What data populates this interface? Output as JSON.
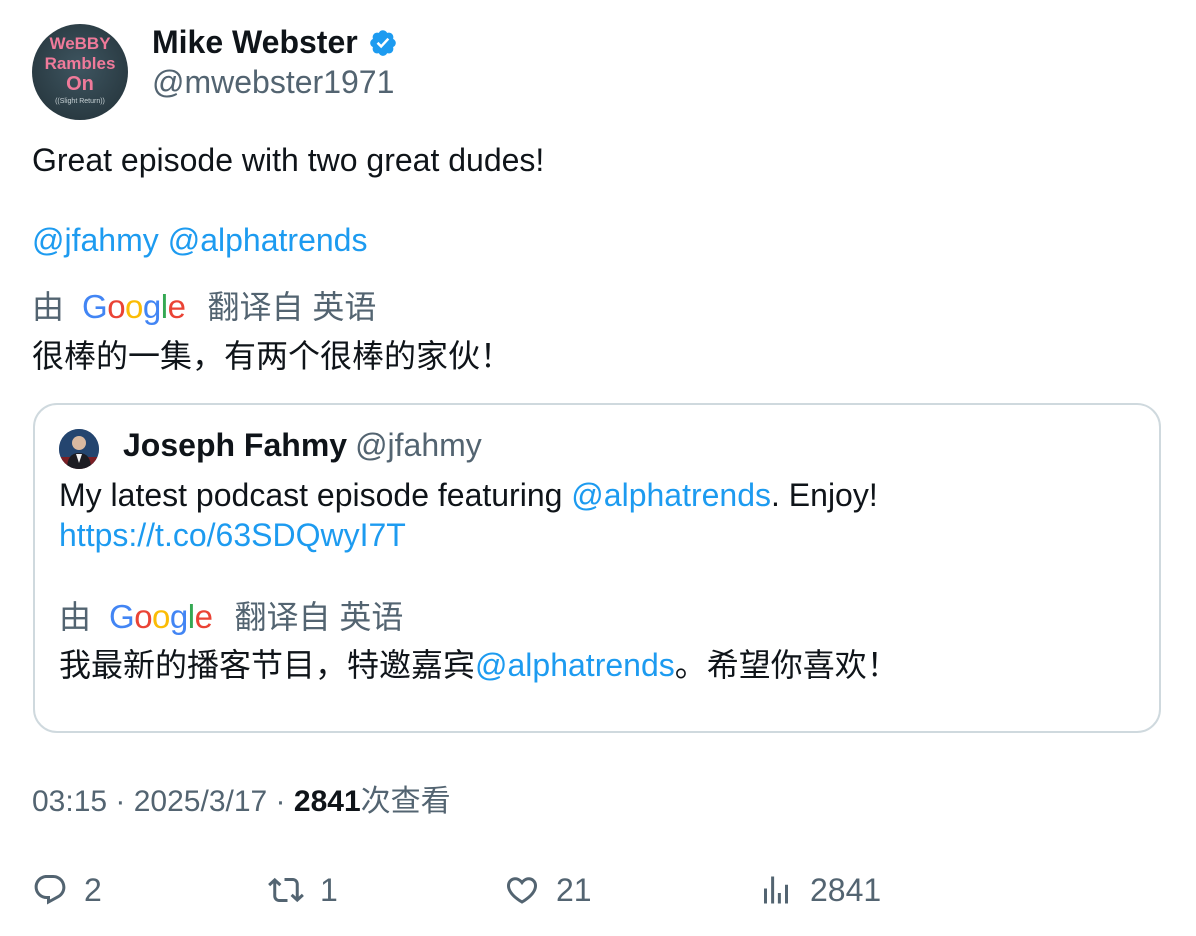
{
  "author": {
    "name": "Mike Webster",
    "handle": "@mwebster1971",
    "verified": true,
    "avatar_text": [
      "WeBBY",
      "Rambles",
      "On",
      "((Slight Return))"
    ]
  },
  "tweet": {
    "text": "Great episode with two great dudes!",
    "mentions": [
      "@jfahmy",
      "@alphatrends"
    ],
    "translation": {
      "prefix": "由",
      "provider": "Google",
      "suffix": "翻译自 英语",
      "text": "很棒的一集，有两个很棒的家伙！"
    }
  },
  "quote": {
    "name": "Joseph Fahmy",
    "handle": "@jfahmy",
    "text_before": "My latest podcast episode featuring ",
    "mention": "@alphatrends",
    "text_after": ". Enjoy!",
    "link": "https://t.co/63SDQwyI7T",
    "translation": {
      "prefix": "由",
      "provider": "Google",
      "suffix": "翻译自 英语",
      "text_before": "我最新的播客节目，特邀嘉宾",
      "mention": "@alphatrends",
      "text_after": "。希望你喜欢！"
    }
  },
  "meta": {
    "time": "03:15",
    "sep1": " · ",
    "date": "2025/3/17",
    "sep2": " · ",
    "views": "2841",
    "views_label": "次查看"
  },
  "actions": {
    "replies": "2",
    "reposts": "1",
    "likes": "21",
    "views": "2841"
  },
  "colors": {
    "link": "#1d9bf0",
    "secondary": "#536471",
    "primary": "#0f1419",
    "border": "#cfd9de"
  }
}
